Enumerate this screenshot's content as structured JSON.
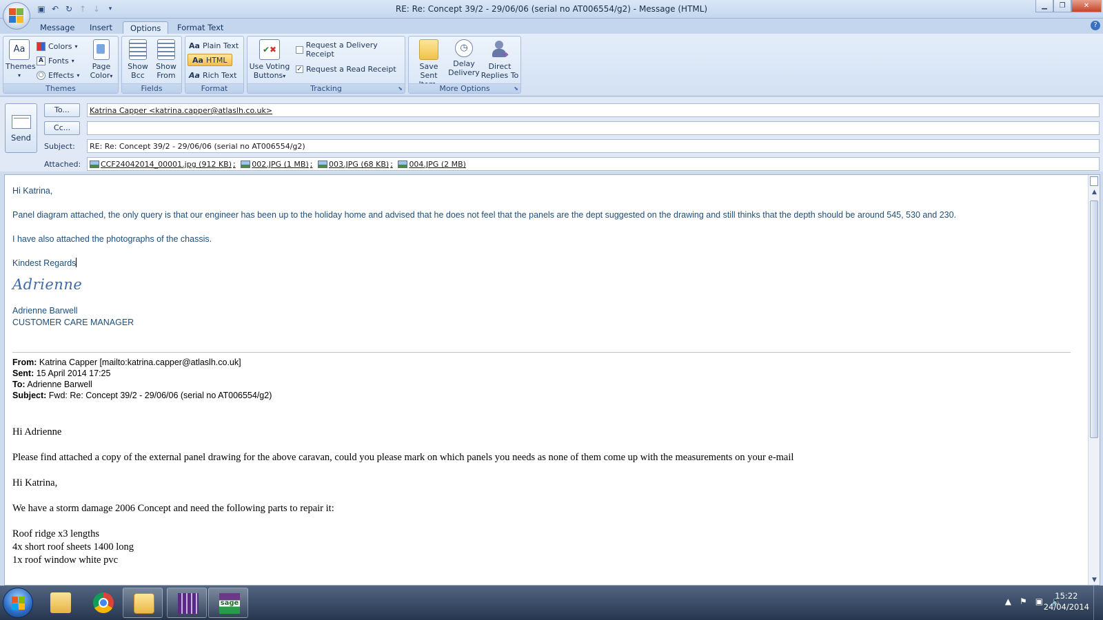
{
  "window": {
    "title": "RE: Re: Concept 39/2 - 29/06/06 (serial no AT006554/g2) - Message (HTML)",
    "min_icon": "minimize-icon",
    "max_icon": "restore-icon",
    "close_icon": "close-icon"
  },
  "tabs": [
    "Message",
    "Insert",
    "Options",
    "Format Text"
  ],
  "active_tab": "Options",
  "ribbon": {
    "themes": {
      "label": "Themes",
      "themes_btn": "Themes",
      "colors": "Colors",
      "fonts": "Fonts",
      "effects": "Effects",
      "page_color_1": "Page",
      "page_color_2": "Color"
    },
    "fields": {
      "label": "Fields",
      "show_bcc_1": "Show",
      "show_bcc_2": "Bcc",
      "show_from_1": "Show",
      "show_from_2": "From"
    },
    "format": {
      "label": "Format",
      "plain": "Plain Text",
      "html": "HTML",
      "rich": "Rich Text"
    },
    "tracking": {
      "label": "Tracking",
      "voting_1": "Use Voting",
      "voting_2": "Buttons",
      "delivery": "Request a Delivery Receipt",
      "read": "Request a Read Receipt",
      "delivery_checked": false,
      "read_checked": true
    },
    "more": {
      "label": "More Options",
      "save_1": "Save Sent",
      "save_2": "Item",
      "delay_1": "Delay",
      "delay_2": "Delivery",
      "direct_1": "Direct",
      "direct_2": "Replies To"
    }
  },
  "header": {
    "send": "Send",
    "to_btn": "To...",
    "cc_btn": "Cc...",
    "subject_label": "Subject:",
    "attached_label": "Attached:",
    "to_value": "Katrina Capper <katrina.capper@atlaslh.co.uk>",
    "cc_value": "",
    "subject_value": "RE: Re: Concept 39/2 - 29/06/06 (serial no AT006554/g2)",
    "attachments": [
      "CCF24042014_00001.jpg (912 KB)",
      "002.JPG (1 MB)",
      "003.JPG (68 KB)",
      "004.JPG (2 MB)"
    ]
  },
  "body": {
    "greeting": "Hi Katrina,",
    "para1": "Panel diagram attached, the only query is that our engineer has been up to the holiday home and advised that he does not feel that the panels are the dept suggested on the drawing and still thinks that the depth should be  around 545, 530 and 230.",
    "para2": "I have also attached the photographs of the chassis.",
    "regards": "Kindest Regards",
    "signature_script": "Adrienne",
    "sig_name": "Adrienne Barwell",
    "sig_title": "CUSTOMER CARE MANAGER",
    "from_label": "From:",
    "from_value": "Katrina Capper [mailto:katrina.capper@atlaslh.co.uk]",
    "sent_label": "Sent:",
    "sent_value": "15 April 2014 17:25",
    "to_label": "To:",
    "to_value": "Adrienne Barwell",
    "subj_label": "Subject:",
    "subj_value": "Fwd: Re: Concept 39/2 - 29/06/06 (serial no AT006554/g2)",
    "q_greeting": "Hi Adrienne",
    "q_para": "Please find attached a copy of the external panel drawing for the above caravan, could you please mark on which panels you needs as none of them come up with the measurements on your e-mail",
    "q2_greeting": "Hi Katrina,",
    "q2_para": "We have a storm damage 2006 Concept and need the following parts to repair it:",
    "parts": [
      "Roof ridge x3 lengths",
      "4x short roof sheets 1400 long",
      "1x roof window white pvc"
    ]
  },
  "taskbar": {
    "time": "15:22",
    "date": "24/04/2014"
  }
}
